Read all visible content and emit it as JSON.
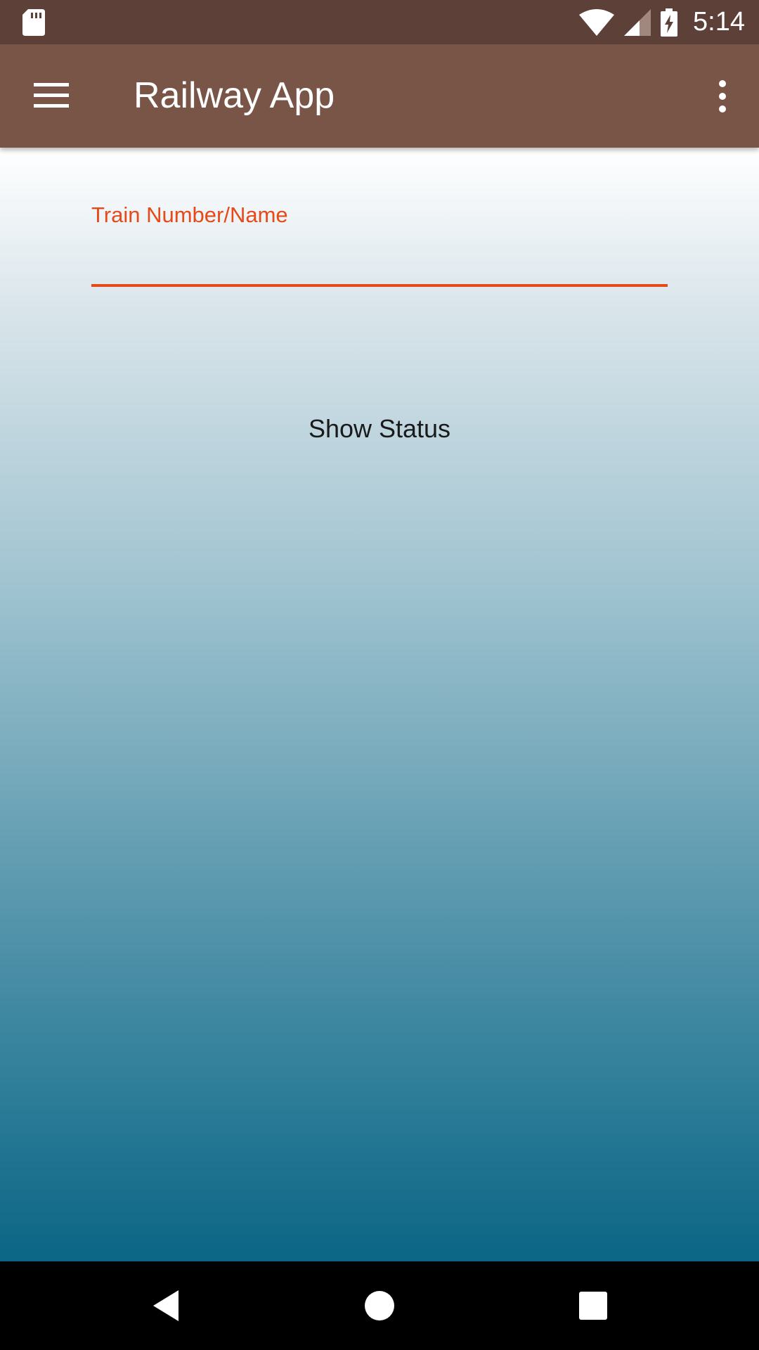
{
  "status_bar": {
    "time": "5:14",
    "icons": [
      "sd-card-icon",
      "wifi-icon",
      "cellular-signal-icon",
      "battery-charging-icon"
    ]
  },
  "app_bar": {
    "title": "Railway App",
    "menu_icon": "hamburger-menu-icon",
    "overflow_icon": "more-vert-icon"
  },
  "form": {
    "train_field": {
      "label": "Train Number/Name",
      "value": "",
      "placeholder": ""
    },
    "show_status_label": "Show Status"
  },
  "nav_bar": {
    "icons": [
      "back-icon",
      "home-icon",
      "recents-icon"
    ]
  },
  "colors": {
    "status_bar": "#5d4037",
    "app_bar": "#795548",
    "accent": "#e64a19",
    "gradient_bottom": "#0b6585"
  }
}
